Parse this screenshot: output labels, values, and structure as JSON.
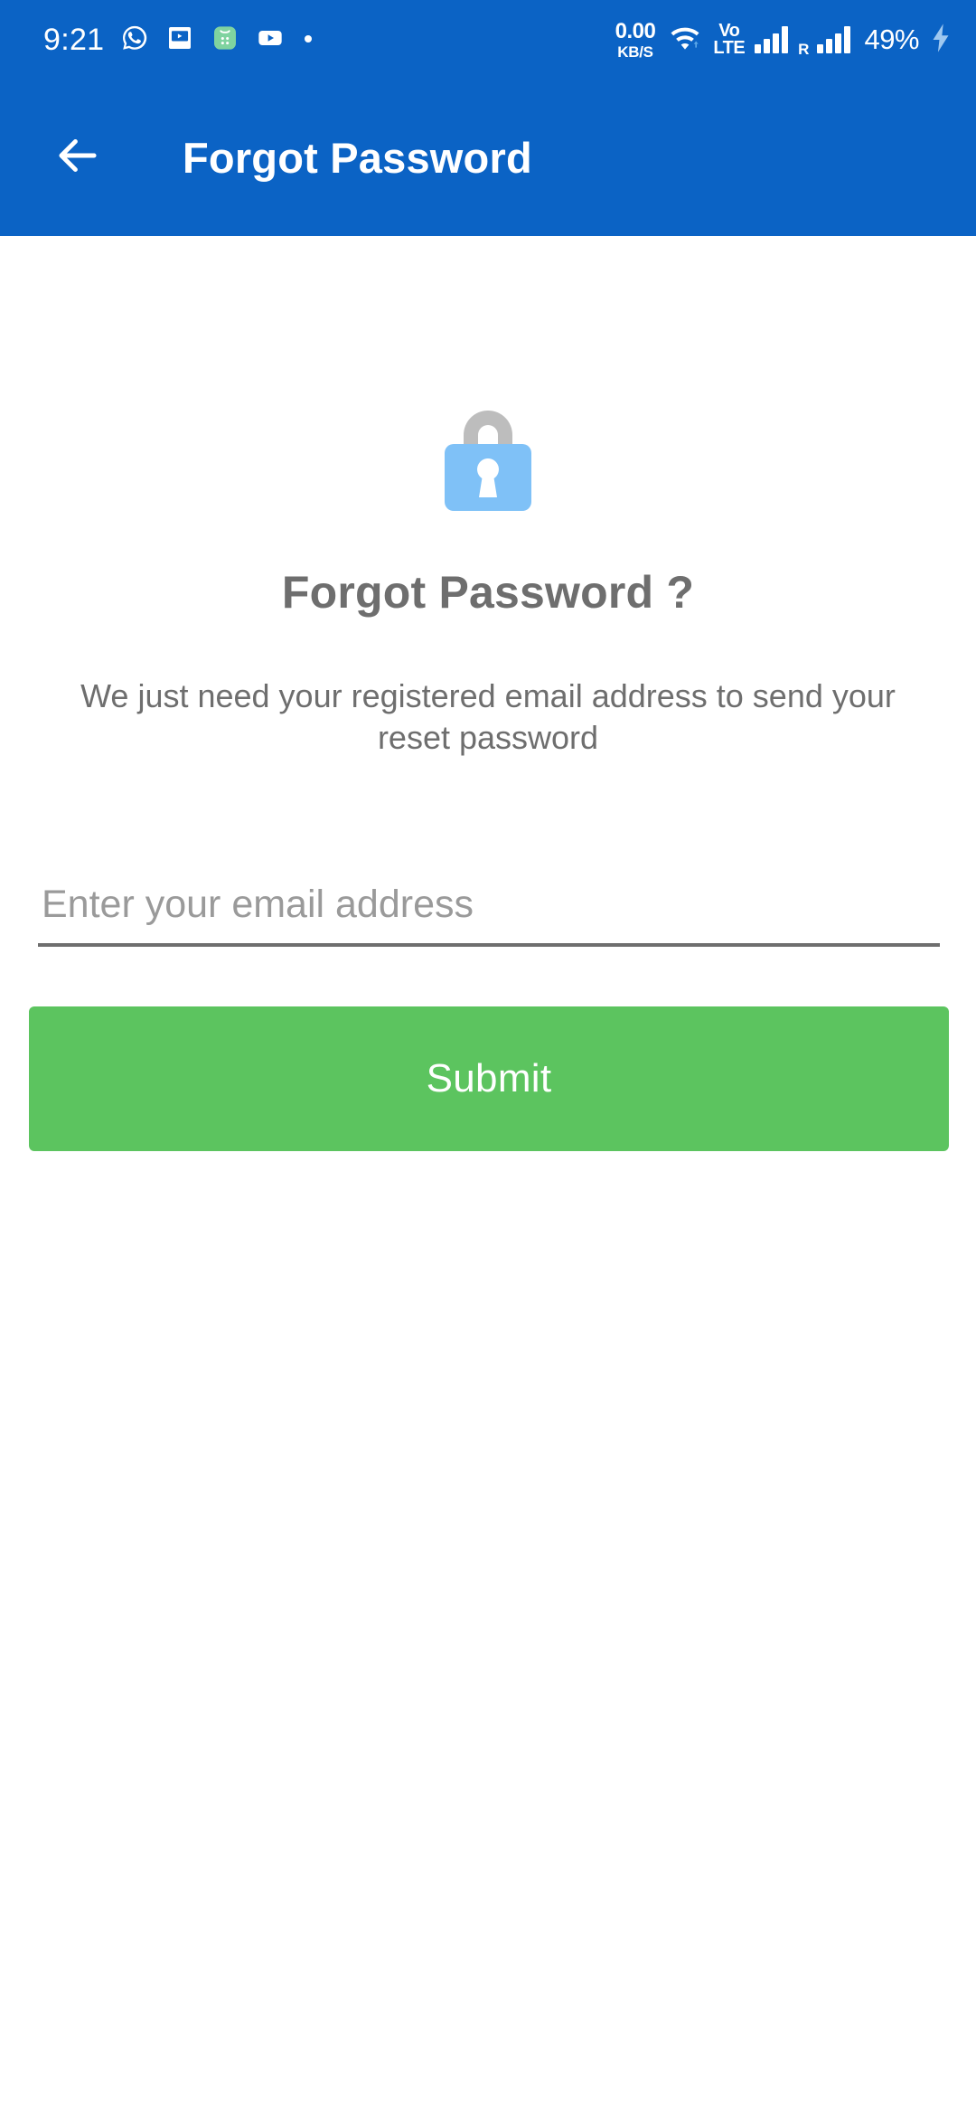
{
  "status_bar": {
    "time": "9:21",
    "net_speed_value": "0.00",
    "net_speed_unit": "KB/S",
    "volte_top": "Vo",
    "volte_bottom": "LTE",
    "roaming_label": "R",
    "battery_percent": "49%",
    "notification_icons": [
      "whatsapp-icon",
      "screen-cast-icon",
      "green-app-icon",
      "youtube-icon",
      "more-notifications-dot-icon"
    ],
    "status_icons": [
      "wifi-icon",
      "volte-icon",
      "signal-sim1-icon",
      "signal-sim2-icon",
      "battery-charging-icon"
    ],
    "colors": {
      "background": "#0B63C5",
      "foreground": "#FFFFFF"
    }
  },
  "app_bar": {
    "back_icon": "arrow-left-icon",
    "title": "Forgot Password",
    "background": "#0B63C5"
  },
  "main": {
    "lock_icon": "padlock-icon",
    "lock_colors": {
      "shackle": "#BDBDBD",
      "body": "#7FC1F7",
      "keyhole": "#FFFFFF"
    },
    "heading": "Forgot Password ?",
    "subtitle": "We just need your registered email address to send your reset password",
    "email_field": {
      "value": "",
      "placeholder": "Enter your email address"
    },
    "submit_label": "Submit",
    "submit_color": "#5CC45F",
    "text_color": "#6E6E6E"
  }
}
